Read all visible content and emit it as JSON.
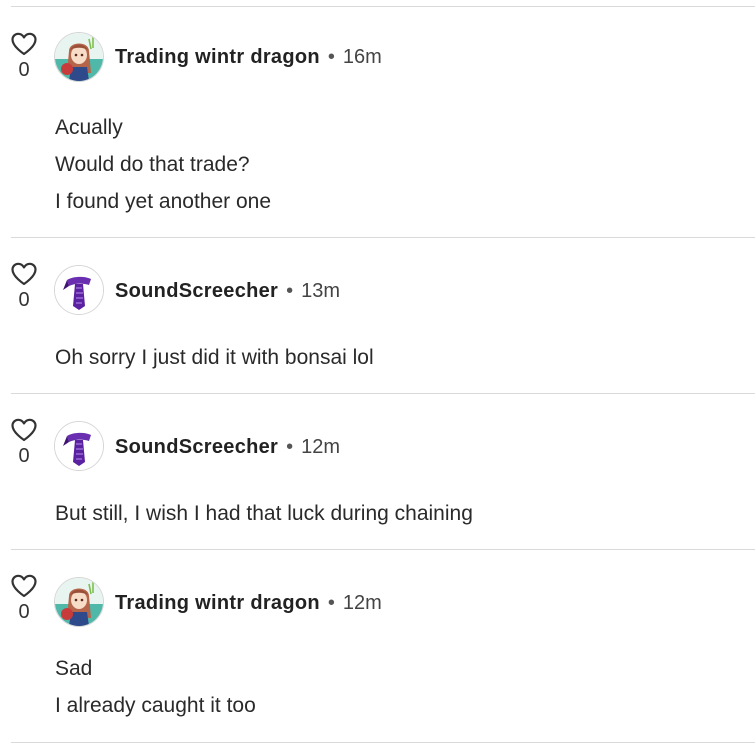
{
  "comments": [
    {
      "likes": "0",
      "author": "Trading wintr dragon",
      "avatar_icon": "anime-girl-avatar-icon",
      "separator": "•",
      "time": "16m",
      "lines": [
        "Acually",
        "Would do that trade?",
        "I found yet another one"
      ]
    },
    {
      "likes": "0",
      "author": "SoundScreecher",
      "avatar_icon": "purple-scarf-avatar-icon",
      "separator": "•",
      "time": "13m",
      "lines": [
        "Oh sorry I just did it with bonsai lol"
      ]
    },
    {
      "likes": "0",
      "author": "SoundScreecher",
      "avatar_icon": "purple-scarf-avatar-icon",
      "separator": "•",
      "time": "12m",
      "lines": [
        "But still, I wish I had that luck during chaining"
      ]
    },
    {
      "likes": "0",
      "author": "Trading wintr dragon",
      "avatar_icon": "anime-girl-avatar-icon",
      "separator": "•",
      "time": "12m",
      "lines": [
        "Sad",
        "I already caught it too"
      ]
    }
  ],
  "colors": {
    "divider": "#d9d9d9",
    "text": "#222222",
    "scarf_purple": "#6a2fb0",
    "avatar_teal": "#4fb8a8"
  }
}
